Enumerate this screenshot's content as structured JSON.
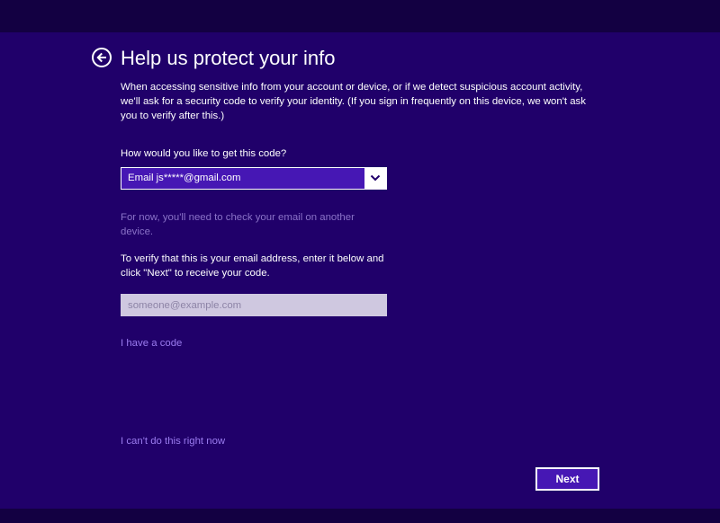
{
  "header": {
    "title": "Help us protect your info",
    "back_icon": "back-arrow-circle-icon"
  },
  "description": "When accessing sensitive info from your account or device, or if we detect suspicious account activity, we'll ask for a security code to verify your identity. (If you sign in frequently on this device, we won't ask you to verify after this.)",
  "method": {
    "question": "How would you like to get this code?",
    "selected": "Email js*****@gmail.com",
    "chevron_icon": "chevron-down-icon"
  },
  "notice": "For now, you'll need to check your email on another device.",
  "verify_instruction": "To verify that this is your email address, enter it below and click \"Next\" to receive your code.",
  "email_input": {
    "value": "",
    "placeholder": "someone@example.com"
  },
  "links": {
    "have_code": "I have a code",
    "cant_now": "I can't do this right now"
  },
  "buttons": {
    "next": "Next"
  },
  "colors": {
    "background": "#20006a",
    "accent": "#4617b4",
    "link": "#9b7cf0",
    "muted_text": "#8a72c8"
  }
}
